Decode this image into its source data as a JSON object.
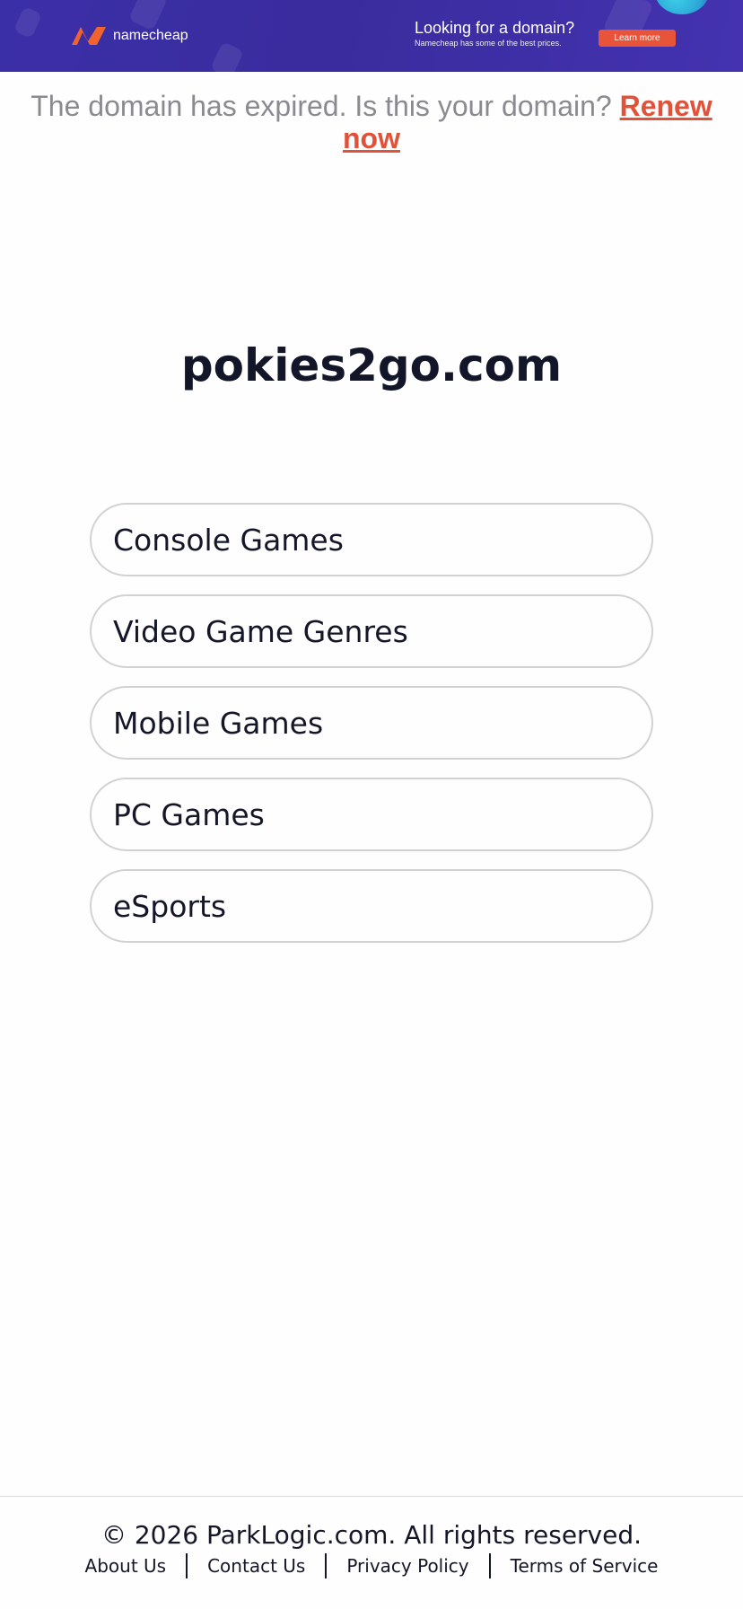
{
  "banner": {
    "brand": "namecheap",
    "headline": "Looking for a domain?",
    "subline": "Namecheap has some of the best prices.",
    "cta": "Learn more"
  },
  "notice": {
    "text": "The domain has expired. Is this your domain?",
    "renew_link": "Renew now"
  },
  "domain": "pokies2go.com",
  "links": [
    {
      "label": "Console Games"
    },
    {
      "label": "Video Game Genres"
    },
    {
      "label": "Mobile Games"
    },
    {
      "label": "PC Games"
    },
    {
      "label": "eSports"
    }
  ],
  "footer": {
    "copyright": "© 2026 ParkLogic.com. All rights reserved.",
    "links": [
      "About Us",
      "Contact Us",
      "Privacy Policy",
      "Terms of Service"
    ]
  },
  "colors": {
    "banner_bg": "#3b2fa8",
    "accent": "#e0533a",
    "text_dark": "#131629",
    "notice_gray": "#8a8a90"
  }
}
